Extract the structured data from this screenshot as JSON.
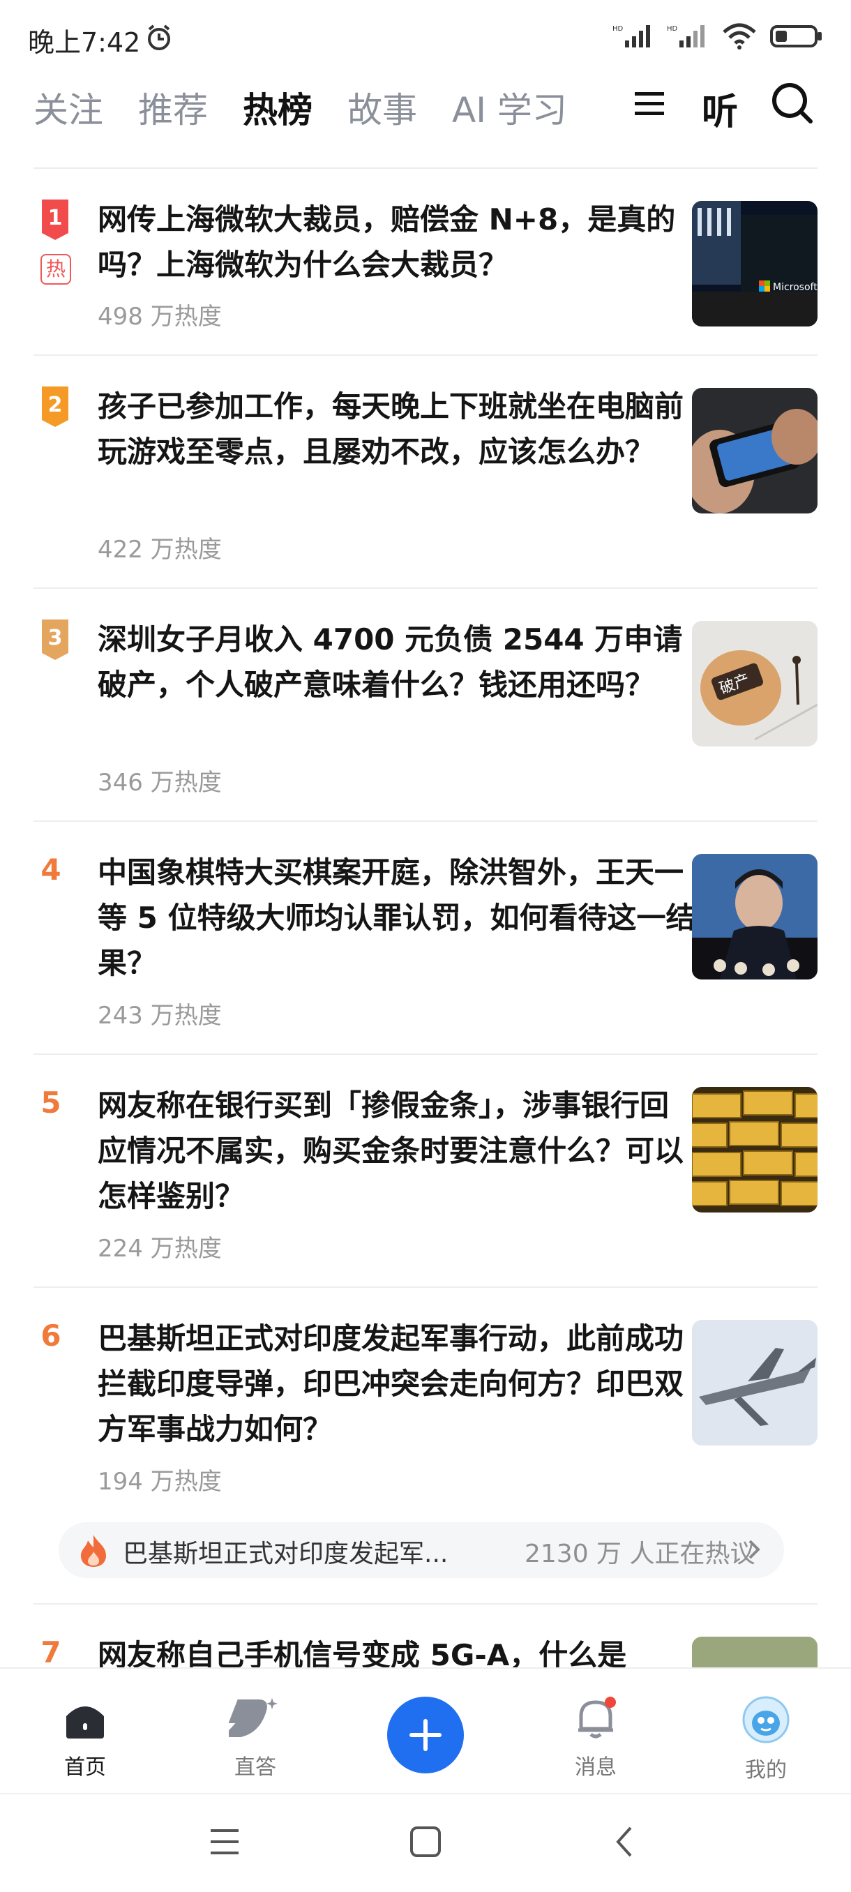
{
  "status_bar": {
    "time": "晚上7:42",
    "battery_icon": "battery-icon",
    "wifi_icon": "wifi-icon",
    "signal_icon": "signal-icon"
  },
  "top_nav": {
    "tabs": [
      {
        "label": "关注",
        "active": false
      },
      {
        "label": "推荐",
        "active": false
      },
      {
        "label": "热榜",
        "active": true
      },
      {
        "label": "故事",
        "active": false
      },
      {
        "label": "AI 学习",
        "active": false
      }
    ],
    "listen_label": "听"
  },
  "hot_list": [
    {
      "rank": "1",
      "hot_tag": "热",
      "title": "网传上海微软大裁员，赔偿金 N+8，是真的吗？上海微软为什么会大裁员？",
      "heat": "498 万热度"
    },
    {
      "rank": "2",
      "title": "孩子已参加工作，每天晚上下班就坐在电脑前玩游戏至零点，且屡劝不改，应该怎么办？",
      "heat": "422 万热度"
    },
    {
      "rank": "3",
      "title": "深圳女子月收入 4700 元负债 2544 万申请破产，个人破产意味着什么？钱还用还吗？",
      "heat": "346 万热度",
      "thumb_text": "破产"
    },
    {
      "rank": "4",
      "title": "中国象棋特大买棋案开庭，除洪智外，王天一等 5 位特级大师均认罪认罚，如何看待这一结果？",
      "heat": "243 万热度"
    },
    {
      "rank": "5",
      "title": "网友称在银行买到「掺假金条」，涉事银行回应情况不属实，购买金条时要注意什么？可以怎样鉴别？",
      "heat": "224 万热度"
    },
    {
      "rank": "6",
      "title": "巴基斯坦正式对印度发起军事行动，此前成功拦截印度导弹，印巴冲突会走向何方？印巴双方军事战力如何？",
      "heat": "194 万热度",
      "related": {
        "text": "巴基斯坦正式对印度发起军...",
        "count": "2130 万 人正在热议"
      }
    },
    {
      "rank": "7",
      "title": "网友称自己手机信号变成 5G-A，什么是"
    }
  ],
  "thumb_brand": "Microsoft",
  "bottom_nav": {
    "items": [
      {
        "label": "首页",
        "icon": "home-icon",
        "active": true
      },
      {
        "label": "直答",
        "icon": "answer-icon",
        "active": false
      },
      {
        "label": "消息",
        "icon": "bell-icon",
        "active": false
      },
      {
        "label": "我的",
        "icon": "avatar-icon",
        "active": false
      }
    ]
  }
}
